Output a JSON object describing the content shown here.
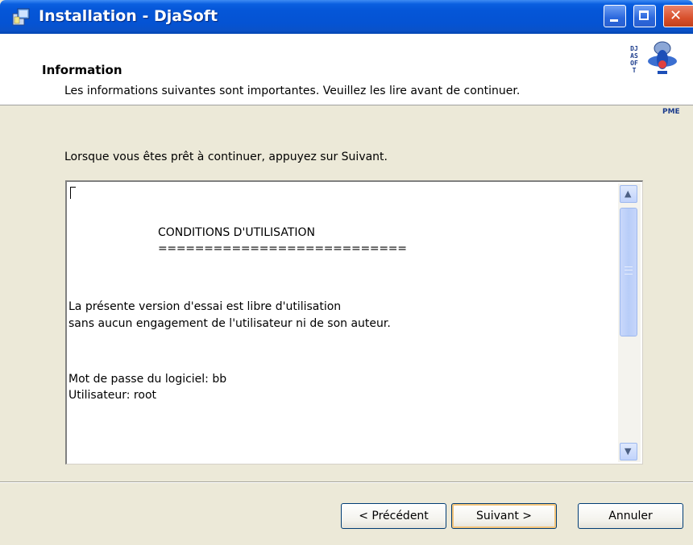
{
  "window": {
    "title": "Installation - DjaSoft",
    "controls": [
      "minimize-icon",
      "maximize-icon",
      "close-icon"
    ],
    "accent_color": "#0553d3"
  },
  "header": {
    "title": "Information",
    "subtitle": "Les informations suivantes sont importantes. Veuillez les lire avant de continuer.",
    "logo_text": "DJASOFT",
    "logo_caption": "PME"
  },
  "body": {
    "instruction": "Lorsque vous êtes prêt à continuer, appuyez sur Suivant.",
    "memo_lines": {
      "heading": "CONDITIONS D'UTILISATION",
      "underline": "===========================",
      "line1": "La présente version d'essai est libre d'utilisation",
      "line2": "sans aucun engagement de l'utilisateur ni de son auteur.",
      "line3": "Mot de passe du logiciel: bb",
      "line4": "Utilisateur: root"
    }
  },
  "buttons": {
    "prev": "< Précédent",
    "next": "Suivant >",
    "cancel": "Annuler"
  }
}
